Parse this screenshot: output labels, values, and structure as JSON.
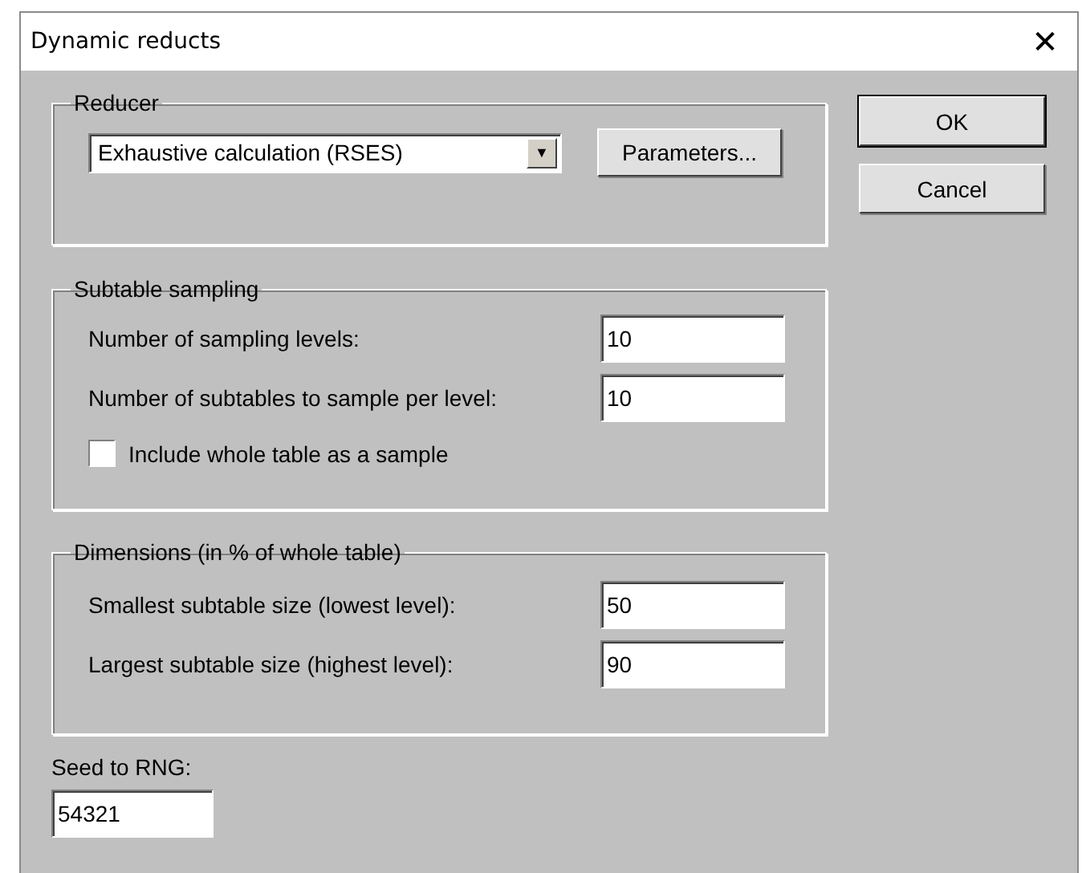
{
  "window": {
    "title": "Dynamic reducts",
    "close": "✕"
  },
  "reducer": {
    "title": "Reducer",
    "dropdown_value": "Exhaustive calculation (RSES)",
    "dropdown_arrow": "▼",
    "parameters_button": "Parameters..."
  },
  "buttons": [
    "OK",
    "Cancel"
  ],
  "subtable_sampling": {
    "title": "Subtable sampling",
    "fields": [
      {
        "label": "Number of sampling levels:",
        "value": "10"
      },
      {
        "label": "Number of subtables to sample per level:",
        "value": "10"
      }
    ],
    "include_whole_table": {
      "label": "Include whole table as a sample",
      "checked": false
    }
  },
  "dimensions": {
    "title": "Dimensions (in % of whole table)",
    "fields": [
      {
        "label": "Smallest subtable size (lowest level):",
        "value": "50"
      },
      {
        "label": "Largest subtable size (highest level):",
        "value": "90"
      }
    ]
  },
  "seed": {
    "label": "Seed to RNG:",
    "value": "54321"
  }
}
